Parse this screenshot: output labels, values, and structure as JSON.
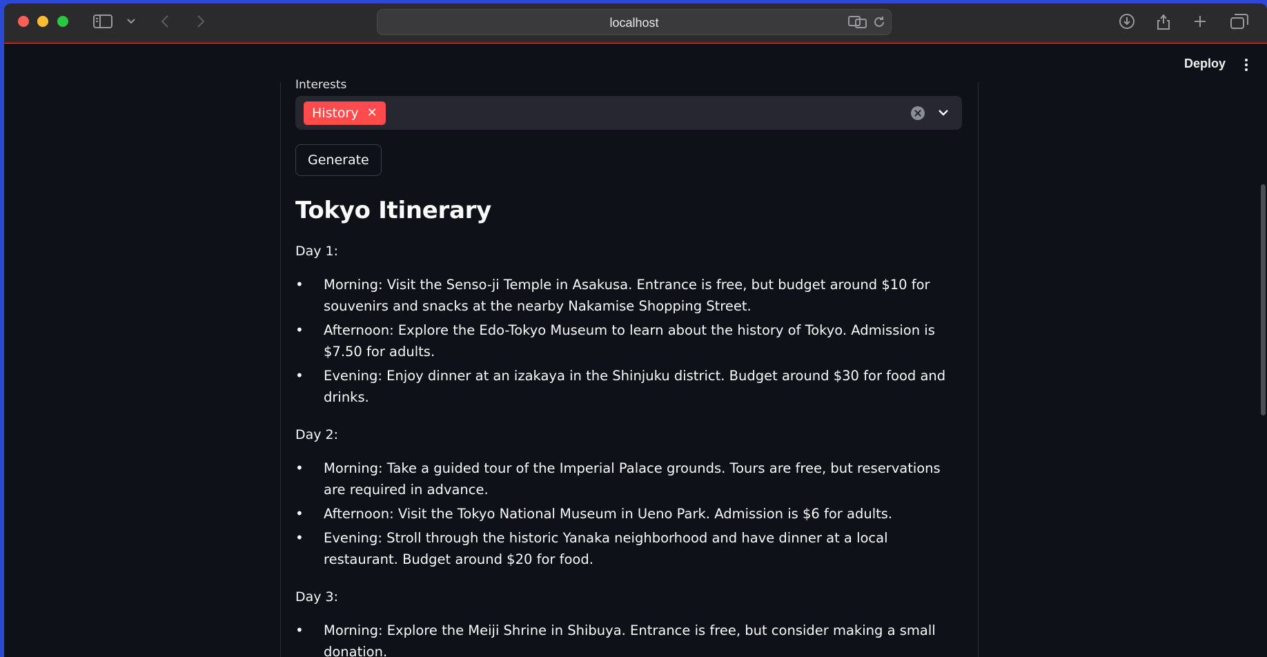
{
  "browser": {
    "url": "localhost"
  },
  "header": {
    "deploy_label": "Deploy"
  },
  "form": {
    "interests_label": "Interests",
    "selected_interests": [
      "History"
    ],
    "generate_label": "Generate"
  },
  "itinerary": {
    "title": "Tokyo Itinerary",
    "days": [
      {
        "label": "Day 1:",
        "items": [
          "Morning: Visit the Senso-ji Temple in Asakusa. Entrance is free, but budget around $10 for souvenirs and snacks at the nearby Nakamise Shopping Street.",
          "Afternoon: Explore the Edo-Tokyo Museum to learn about the history of Tokyo. Admission is $7.50 for adults.",
          "Evening: Enjoy dinner at an izakaya in the Shinjuku district. Budget around $30 for food and drinks."
        ]
      },
      {
        "label": "Day 2:",
        "items": [
          "Morning: Take a guided tour of the Imperial Palace grounds. Tours are free, but reservations are required in advance.",
          "Afternoon: Visit the Tokyo National Museum in Ueno Park. Admission is $6 for adults.",
          "Evening: Stroll through the historic Yanaka neighborhood and have dinner at a local restaurant. Budget around $20 for food."
        ]
      },
      {
        "label": "Day 3:",
        "items": [
          "Morning: Explore the Meiji Shrine in Shibuya. Entrance is free, but consider making a small donation."
        ]
      }
    ]
  },
  "colors": {
    "accent": "#ff4b4b",
    "background": "#0e1117",
    "input_bg": "#262730"
  }
}
